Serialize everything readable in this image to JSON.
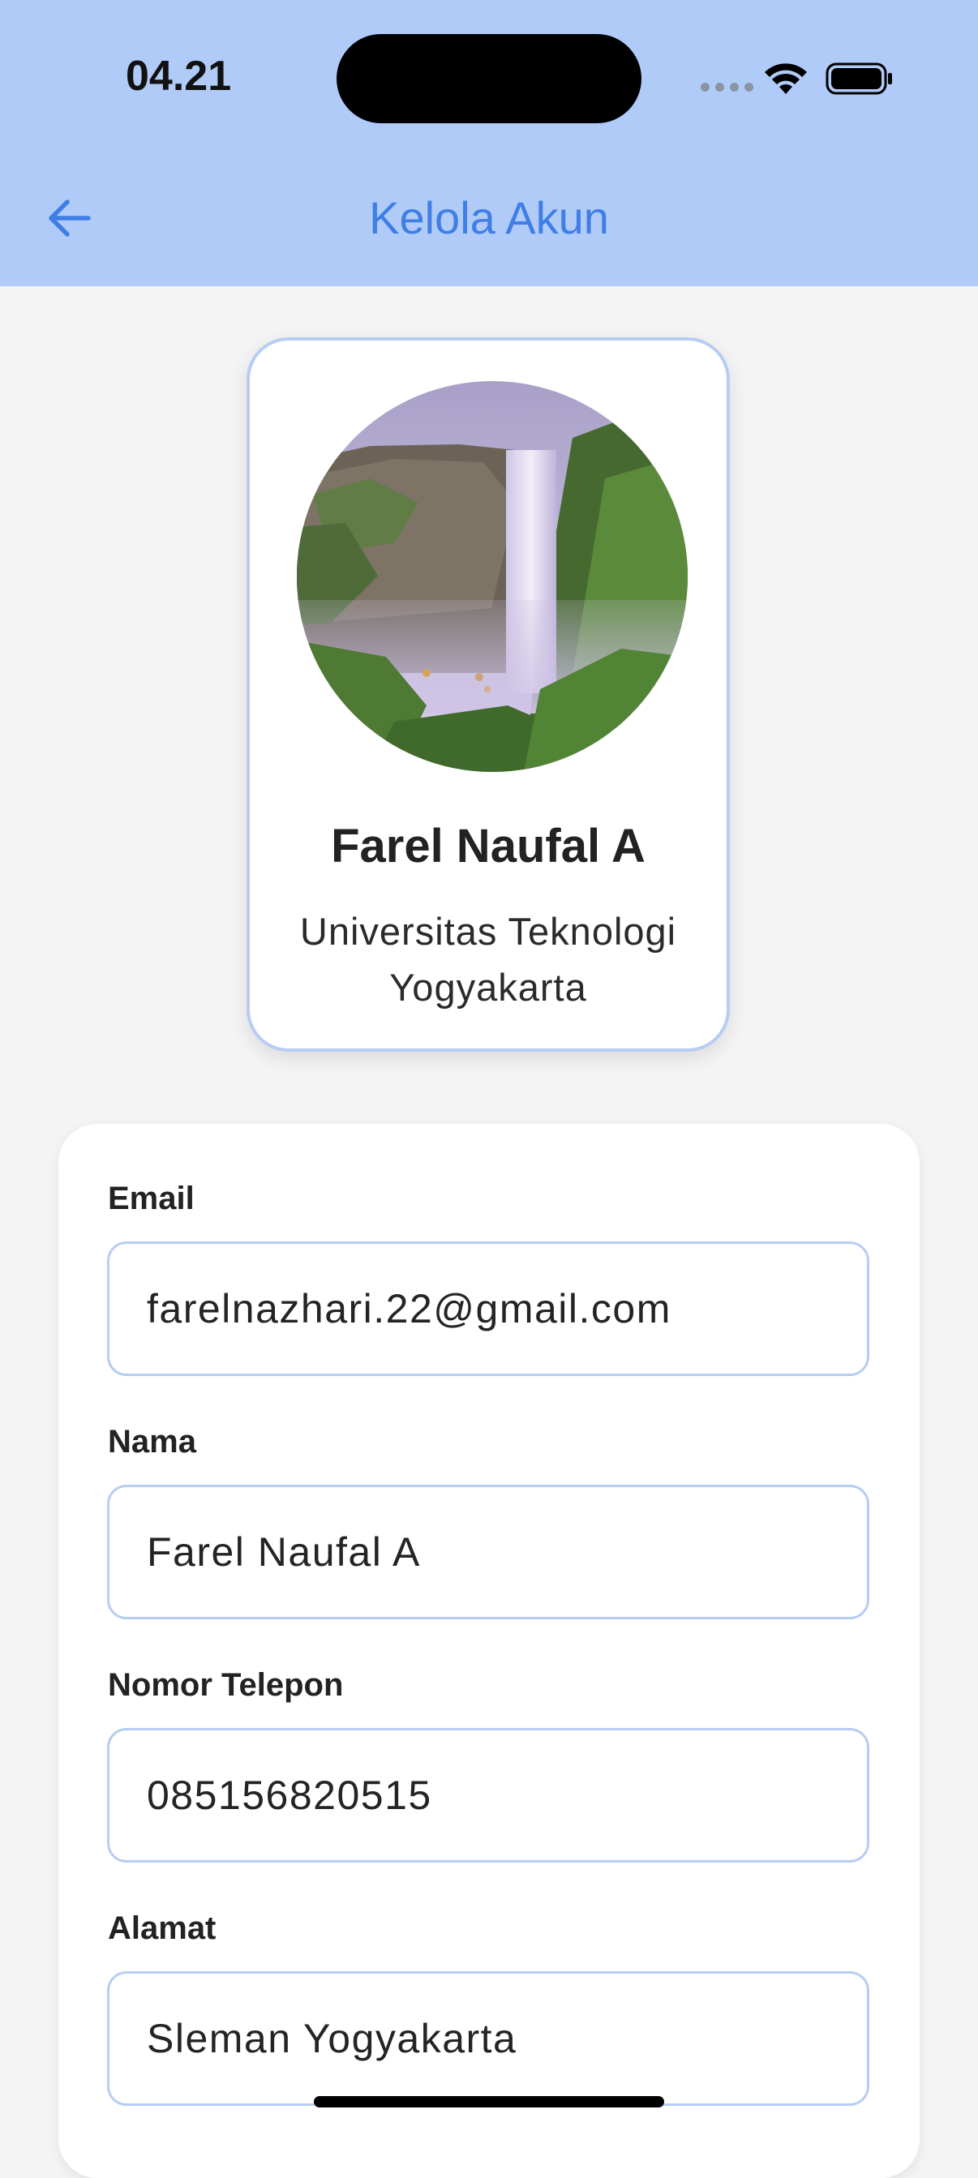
{
  "status_bar": {
    "time": "04.21"
  },
  "header": {
    "title": "Kelola Akun",
    "back_icon": "arrow-left-icon"
  },
  "profile": {
    "name": "Farel Naufal A",
    "organization": "Universitas Teknologi Yogyakarta",
    "avatar": "waterfall-photo"
  },
  "form": {
    "email": {
      "label": "Email",
      "value": "farelnazhari.22@gmail.com"
    },
    "name": {
      "label": "Nama",
      "value": "Farel Naufal A"
    },
    "phone": {
      "label": "Nomor Telepon",
      "value": "085156820515"
    },
    "address": {
      "label": "Alamat",
      "value": "Sleman Yogyakarta"
    }
  },
  "colors": {
    "header_bg": "#b0cbf8",
    "accent": "#3f7ee6",
    "border": "#b7cdf4",
    "page_bg": "#f4f4f4"
  }
}
